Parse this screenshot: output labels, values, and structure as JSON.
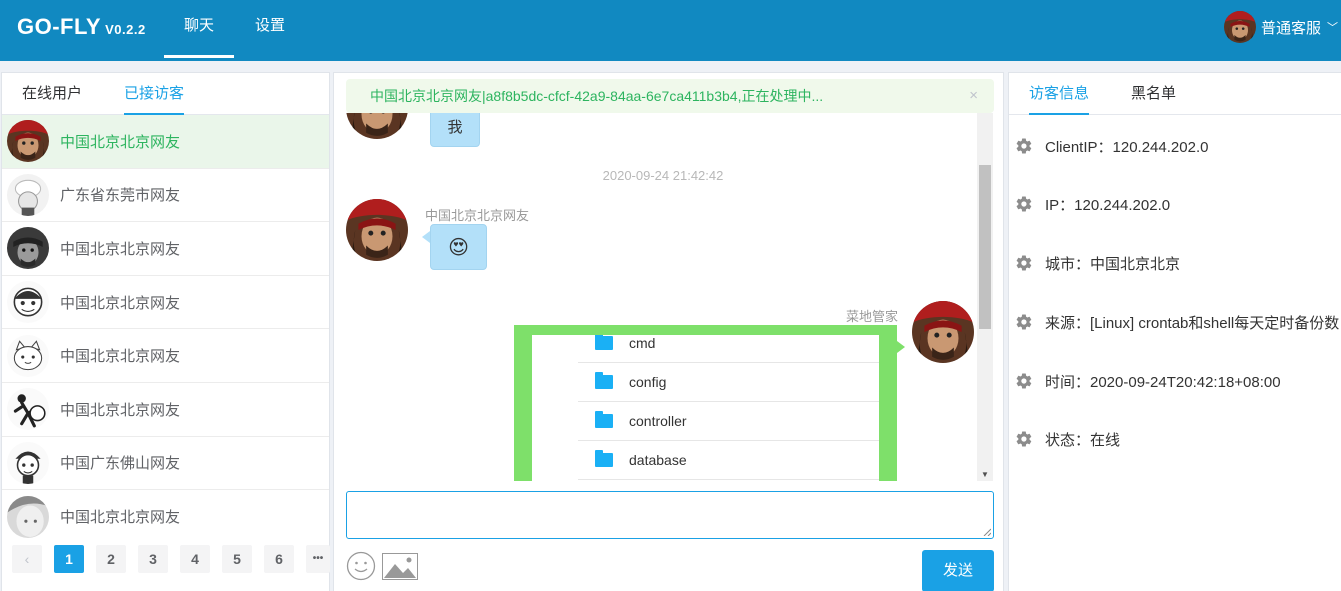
{
  "header": {
    "logo": "GO-FLY",
    "version": "V0.2.2",
    "nav": [
      "聊天",
      "设置"
    ],
    "user_name": "普通客服",
    "caret_icon": "chevron-down-icon"
  },
  "left": {
    "tabs": [
      "在线用户",
      "已接访客"
    ],
    "visitors": [
      {
        "name": "中国北京北京网友"
      },
      {
        "name": "广东省东莞市网友"
      },
      {
        "name": "中国北京北京网友"
      },
      {
        "name": "中国北京北京网友"
      },
      {
        "name": "中国北京北京网友"
      },
      {
        "name": "中国北京北京网友"
      },
      {
        "name": "中国广东佛山网友"
      },
      {
        "name": "中国北京北京网友"
      }
    ],
    "pagination": {
      "prev": "‹",
      "pages": [
        "1",
        "2",
        "3",
        "4",
        "5",
        "6"
      ],
      "more": "•••",
      "current": "1"
    }
  },
  "chat": {
    "alert": "中国北京北京网友|a8f8b5dc-cfcf-42a9-84aa-6e7ca411b3b4,正在处理中...",
    "alert_close": "×",
    "msg1_text": "我",
    "time": "2020-09-24 21:42:42",
    "msg2_sender": "中国北京北京网友",
    "msg2_emoji": "😍",
    "msg3_sender": "菜地管家",
    "files": [
      "cmd",
      "config",
      "controller",
      "database"
    ],
    "send_label": "发送"
  },
  "right": {
    "tabs": [
      "访客信息",
      "黑名单"
    ],
    "info": [
      {
        "label": "ClientIP：120.244.202.0"
      },
      {
        "label": "IP：120.244.202.0"
      },
      {
        "label": "城市：中国北京北京"
      },
      {
        "label": "来源：[Linux] crontab和shell每天定时备份数"
      },
      {
        "label": "时间：2020-09-24T20:42:18+08:00"
      },
      {
        "label": "状态：在线"
      }
    ]
  },
  "colors": {
    "header": "#1189c1",
    "accent": "#1aa1e5",
    "success": "#2db45f"
  }
}
